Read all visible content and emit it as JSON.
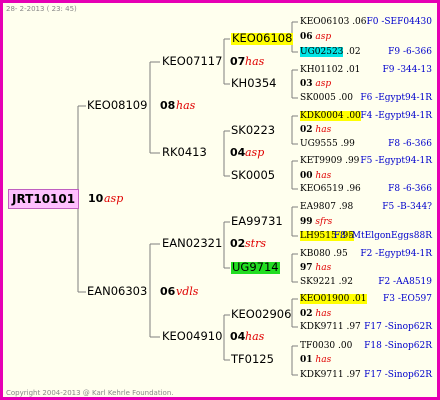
{
  "header": {
    "date": "28- 2-2013 ( 23: 45)"
  },
  "footer": {
    "copyright": "Copyright 2004-2013 @ Karl Kehrle Foundation."
  },
  "root": {
    "name": "JRT10101",
    "number": "10",
    "race": "asp"
  },
  "gen1": [
    {
      "name": "KEO08109",
      "number": "08",
      "race": "has"
    },
    {
      "name": "EAN06303",
      "number": "06",
      "race": "vdls"
    }
  ],
  "gen2": [
    {
      "name": "KEO07117",
      "number": "07",
      "race": "has"
    },
    {
      "name": "RK0413",
      "number": "04",
      "race": "asp"
    },
    {
      "name": "EAN02321",
      "number": "02",
      "race": "strs"
    },
    {
      "name": "KEO04910",
      "number": "04",
      "race": "has"
    }
  ],
  "gen3": [
    {
      "name": "KEO06108",
      "number": "",
      "race": ""
    },
    {
      "name": "KH0354",
      "number": "",
      "race": ""
    },
    {
      "name": "SK0223",
      "number": "",
      "race": ""
    },
    {
      "name": "SK0005",
      "number": "",
      "race": ""
    },
    {
      "name": "EA99731",
      "number": "",
      "race": ""
    },
    {
      "name": "UG9714",
      "number": "",
      "race": ""
    },
    {
      "name": "KEO02906",
      "number": "",
      "race": ""
    },
    {
      "name": "TF0125",
      "number": "",
      "race": ""
    }
  ],
  "gen3_children": [
    {
      "number": "06",
      "race": "asp"
    },
    {
      "number": "03",
      "race": "asp"
    },
    {
      "number": "02",
      "race": "has"
    },
    {
      "number": "00",
      "race": "has"
    },
    {
      "number": "99",
      "race": "sfrs"
    },
    {
      "number": "97",
      "race": "has"
    },
    {
      "number": "02",
      "race": "has"
    },
    {
      "number": "01",
      "race": "has"
    }
  ],
  "gen4": [
    {
      "name": "KEO06103",
      "year": ".06",
      "info": "F0 -SEF04430"
    },
    {
      "name": "UG02523",
      "year": ".02",
      "info": "F9 -6-366"
    },
    {
      "name": "KH01102",
      "year": ".01",
      "info": "F9 -344-13"
    },
    {
      "name": "SK0005",
      "year": ".00",
      "info": "F6 -Egypt94-1R"
    },
    {
      "name": "KDK0004",
      "year": ".00",
      "info": "F4 -Egypt94-1R"
    },
    {
      "name": "UG9555",
      "year": ".99",
      "info": "F8 -6-366"
    },
    {
      "name": "KET9909",
      "year": ".99",
      "info": "F5 -Egypt94-1R"
    },
    {
      "name": "KEO6519",
      "year": ".96",
      "info": "F8 -6-366"
    },
    {
      "name": "EA9807",
      "year": ".98",
      "info": "F5 -B-344?"
    },
    {
      "name": "LH9515",
      "year": ".95",
      "info": "F8 -MtElgonEggs88R"
    },
    {
      "name": "KB080",
      "year": ".95",
      "info": "F2 -Egypt94-1R"
    },
    {
      "name": "SK9221",
      "year": ".92",
      "info": "F2 -AA8519"
    },
    {
      "name": "KEO01900",
      "year": ".01",
      "info": "F3 -EO597"
    },
    {
      "name": "KDK9711",
      "year": ".97",
      "info": "F17 -Sinop62R"
    },
    {
      "name": "TF0030",
      "year": ".00",
      "info": "F18 -Sinop62R"
    },
    {
      "name": "KDK9711",
      "year": ".97",
      "info": "F17 -Sinop62R"
    }
  ],
  "colors": {
    "frame": "#e600b4",
    "background": "#ffffee",
    "lines": "#7f7f7f",
    "race": "#e00000",
    "info": "#0000cc",
    "highlight_yellow": "#ffff00",
    "highlight_cyan": "#00e5e5",
    "highlight_green": "#22dd22",
    "root_bg": "#ffc0ff"
  }
}
